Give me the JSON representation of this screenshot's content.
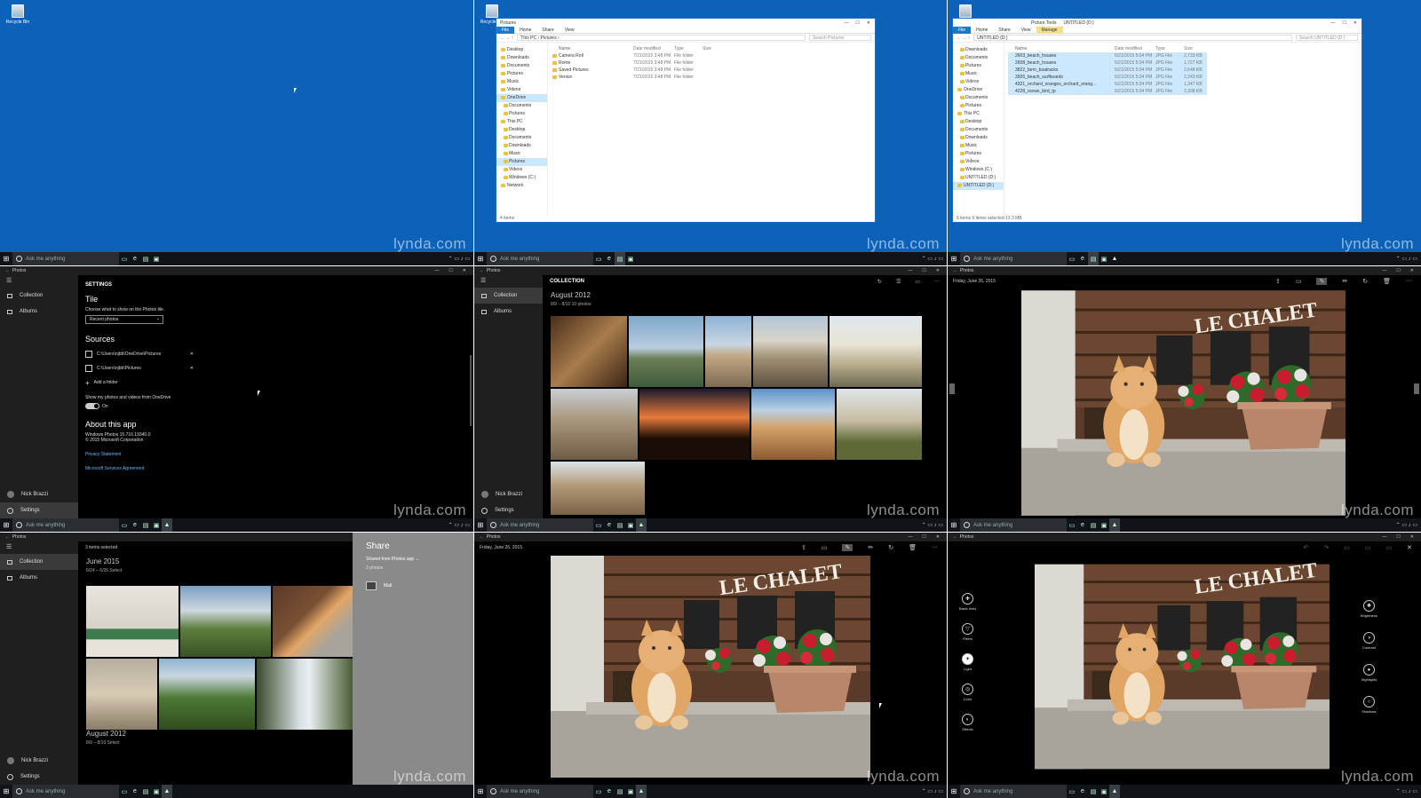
{
  "desktop": {
    "recycle_bin": "Recycle Bin"
  },
  "taskbar": {
    "search_placeholder": "Ask me anything"
  },
  "watermark": "lynda.com",
  "explorer1": {
    "title": "Pictures",
    "ribbon": [
      "File",
      "Home",
      "Share",
      "View"
    ],
    "path": "This PC › Pictures ›",
    "search": "Search Pictures",
    "nav": [
      "Desktop",
      "Downloads",
      "Documents",
      "Pictures",
      "Music",
      "Videos",
      "OneDrive",
      "Documents",
      "Pictures",
      "This PC",
      "Desktop",
      "Documents",
      "Downloads",
      "Music",
      "Pictures",
      "Videos",
      "Windows (C:)",
      "Network"
    ],
    "headers": [
      "Name",
      "Date modified",
      "Type",
      "Size"
    ],
    "rows": [
      [
        "Camera Roll",
        "7/21/2015 3:48 PM",
        "File folder",
        ""
      ],
      [
        "Rome",
        "7/21/2015 3:48 PM",
        "File folder",
        ""
      ],
      [
        "Saved Pictures",
        "7/21/2015 3:48 PM",
        "File folder",
        ""
      ],
      [
        "Venice",
        "7/21/2015 3:48 PM",
        "File folder",
        ""
      ]
    ],
    "status": "4 items"
  },
  "explorer2": {
    "title": "UNTITLED (D:)",
    "context_tab": "Picture Tools",
    "ribbon": [
      "File",
      "Home",
      "Share",
      "View",
      "Manage"
    ],
    "path": "UNTITLED (D:)",
    "search": "Search UNTITLED (D:)",
    "nav": [
      "Downloads",
      "Documents",
      "Pictures",
      "Music",
      "Videos",
      "OneDrive",
      "Documents",
      "Pictures",
      "This PC",
      "Desktop",
      "Documents",
      "Downloads",
      "Music",
      "Pictures",
      "Videos",
      "Windows (C:)",
      "UNTITLED (D:)",
      "UNTITLED (D:)"
    ],
    "headers": [
      "Name",
      "Date modified",
      "Type",
      "Size"
    ],
    "rows": [
      [
        "2603_beach_houses",
        "5/21/2015 5:04 PM",
        "JPG File",
        "2,733 KB"
      ],
      [
        "2608_beach_houses",
        "5/21/2015 5:04 PM",
        "JPG File",
        "1,727 KB"
      ],
      [
        "3822_farm_boatracks",
        "5/21/2015 5:04 PM",
        "JPG File",
        "2,648 KB"
      ],
      [
        "3926_beach_surfboards",
        "5/21/2015 5:04 PM",
        "JPG File",
        "2,243 KB"
      ],
      [
        "4321_orchard_oranges_orchard_orang...",
        "5/21/2015 5:04 PM",
        "JPG File",
        "1,347 KB"
      ],
      [
        "4228_ocean_bird_tp",
        "5/21/2015 5:04 PM",
        "JPG File",
        "2,308 KB"
      ]
    ],
    "status": "6 items   6 items selected  13.3 MB"
  },
  "photos_app": {
    "title": "Photos",
    "nav_collection": "Collection",
    "nav_albums": "Albums",
    "user": "Nick Brazzi",
    "settings_label": "Settings"
  },
  "settings_page": {
    "header": "SETTINGS",
    "tile_heading": "Tile",
    "tile_desc": "Choose what to show on the Photos tile.",
    "tile_value": "Recent photos",
    "sources_heading": "Sources",
    "sources": [
      "C:\\Users\\njbb\\OneDrive\\Pictures",
      "C:\\Users\\njbb\\Pictures"
    ],
    "add_folder": "Add a folder",
    "onedrive_label": "Show my photos and videos from OneDrive",
    "onedrive_state": "On",
    "about_heading": "About this app",
    "version": "Windows Photos 15.716.19340.0",
    "copyright": "© 2015 Microsoft Corporation",
    "privacy": "Privacy Statement",
    "agreement": "Microsoft Services Agreement"
  },
  "collection_page": {
    "header": "COLLECTION",
    "month": "August 2012",
    "sub": "8/9 – 8/10   10 photos"
  },
  "viewer": {
    "date": "Friday, June 26, 2015",
    "sign_text": "LE CHALET"
  },
  "select_page": {
    "selected": "3 items selected",
    "month1": "June 2015",
    "sub1": "6/24 – 6/26   Select",
    "month2": "August 2012",
    "sub2": "8/9 – 8/10   Select"
  },
  "share_panel": {
    "title": "Share",
    "from": "Shared from Photos app ⌄",
    "count": "3 photos",
    "mail": "Mail"
  },
  "edit_tools_left": [
    "Basic fixes",
    "Filters",
    "Light",
    "Color",
    "Effects"
  ],
  "edit_tools_right": [
    "Brightness",
    "Contrast",
    "Highlights",
    "Shadows"
  ]
}
